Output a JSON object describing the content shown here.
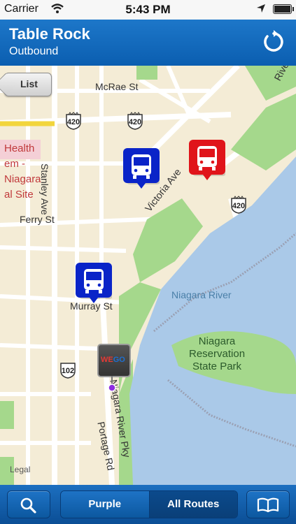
{
  "status_bar": {
    "carrier": "Carrier",
    "time": "5:43 PM"
  },
  "header": {
    "title": "Table Rock",
    "subtitle": "Outbound",
    "refresh_icon": "refresh-icon"
  },
  "map": {
    "list_button_label": "List",
    "street_labels": {
      "mcrae": "McRae St",
      "stanley": "Stanley Ave",
      "victoria": "Victoria Ave",
      "ferry": "Ferry St",
      "murray": "Murray St",
      "portage": "Portage Rd",
      "parkway": "Niagara River Pky",
      "river_partial": "Rive"
    },
    "water_label": "Niagara River",
    "park_label": "Niagara\nReservation\nState Park",
    "poi_lines": [
      "Health",
      "em -",
      "Niagara",
      "al Site"
    ],
    "shields": [
      "420",
      "420",
      "420",
      "102"
    ],
    "stop_marker_text": "WEGO",
    "legal": "Legal"
  },
  "toolbar": {
    "search_icon": "search-icon",
    "segments": [
      "Purple",
      "All Routes"
    ],
    "book_icon": "book-icon"
  }
}
